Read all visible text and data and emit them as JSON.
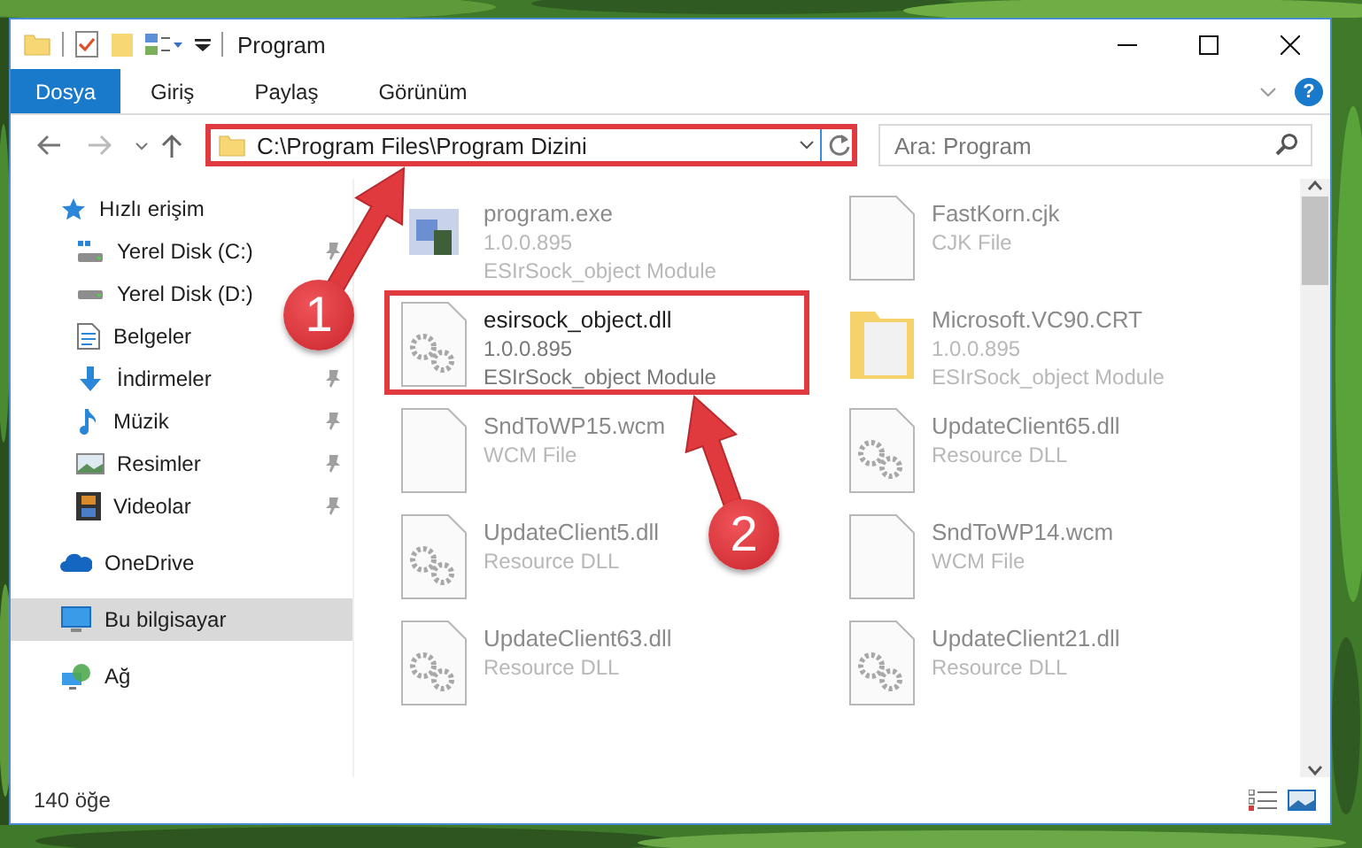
{
  "window": {
    "title": "Program"
  },
  "ribbon_tabs": [
    {
      "label": "Dosya",
      "selected": true
    },
    {
      "label": "Giriş",
      "selected": false
    },
    {
      "label": "Paylaş",
      "selected": false
    },
    {
      "label": "Görünüm",
      "selected": false
    }
  ],
  "help": {
    "label": "?"
  },
  "address": {
    "path": "C:\\Program Files\\Program Dizini",
    "outlined": true
  },
  "search": {
    "placeholder": "Ara: Program"
  },
  "sidebar": {
    "items": [
      {
        "label": "Hızlı erişim",
        "kind": "star",
        "pinned": false,
        "selected": false,
        "children": [
          {
            "label": "Yerel Disk (C:)",
            "kind": "system-drive",
            "pinned": true,
            "selected": false
          },
          {
            "label": "Yerel Disk (D:)",
            "kind": "drive",
            "pinned": false,
            "selected": false
          },
          {
            "label": "Belgeler",
            "kind": "document",
            "pinned": false,
            "selected": false
          },
          {
            "label": "İndirmeler",
            "kind": "download",
            "pinned": true,
            "selected": false
          },
          {
            "label": "Müzik",
            "kind": "music",
            "pinned": true,
            "selected": false
          },
          {
            "label": "Resimler",
            "kind": "pictures",
            "pinned": true,
            "selected": false
          },
          {
            "label": "Videolar",
            "kind": "videos",
            "pinned": true,
            "selected": false
          }
        ]
      },
      {
        "label": "OneDrive",
        "kind": "cloud",
        "pinned": false,
        "selected": false
      },
      {
        "label": "Bu bilgisayar",
        "kind": "computer",
        "pinned": false,
        "selected": true
      },
      {
        "label": "Ağ",
        "kind": "network",
        "pinned": false,
        "selected": false
      }
    ]
  },
  "files": [
    {
      "name": "program.exe",
      "details": [
        "1.0.0.895",
        "ESIrSock_object Module"
      ],
      "kind": "app",
      "dimmed": true,
      "outlined": false
    },
    {
      "name": "FastKorn.cjk",
      "details": [
        "CJK File"
      ],
      "kind": "file",
      "dimmed": true,
      "outlined": false
    },
    {
      "name": "esirsock_object.dll",
      "details": [
        "1.0.0.895",
        "ESIrSock_object Module"
      ],
      "kind": "dll",
      "dimmed": false,
      "outlined": true
    },
    {
      "name": "Microsoft.VC90.CRT",
      "details": [
        "1.0.0.895",
        "ESIrSock_object Module"
      ],
      "kind": "folder",
      "dimmed": true,
      "outlined": false
    },
    {
      "name": "SndToWP15.wcm",
      "details": [
        "WCM File"
      ],
      "kind": "file",
      "dimmed": true,
      "outlined": false
    },
    {
      "name": "UpdateClient65.dll",
      "details": [
        "Resource DLL"
      ],
      "kind": "dll",
      "dimmed": true,
      "outlined": false
    },
    {
      "name": "UpdateClient5.dll",
      "details": [
        "Resource DLL"
      ],
      "kind": "dll",
      "dimmed": true,
      "outlined": false
    },
    {
      "name": "SndToWP14.wcm",
      "details": [
        "WCM File"
      ],
      "kind": "file",
      "dimmed": true,
      "outlined": false
    },
    {
      "name": "UpdateClient63.dll",
      "details": [
        "Resource DLL"
      ],
      "kind": "dll",
      "dimmed": true,
      "outlined": false
    },
    {
      "name": "UpdateClient21.dll",
      "details": [
        "Resource DLL"
      ],
      "kind": "dll",
      "dimmed": true,
      "outlined": false
    }
  ],
  "annotations": [
    {
      "label": "1"
    },
    {
      "label": "2"
    }
  ],
  "status_bar": {
    "count": "140 öğe"
  }
}
